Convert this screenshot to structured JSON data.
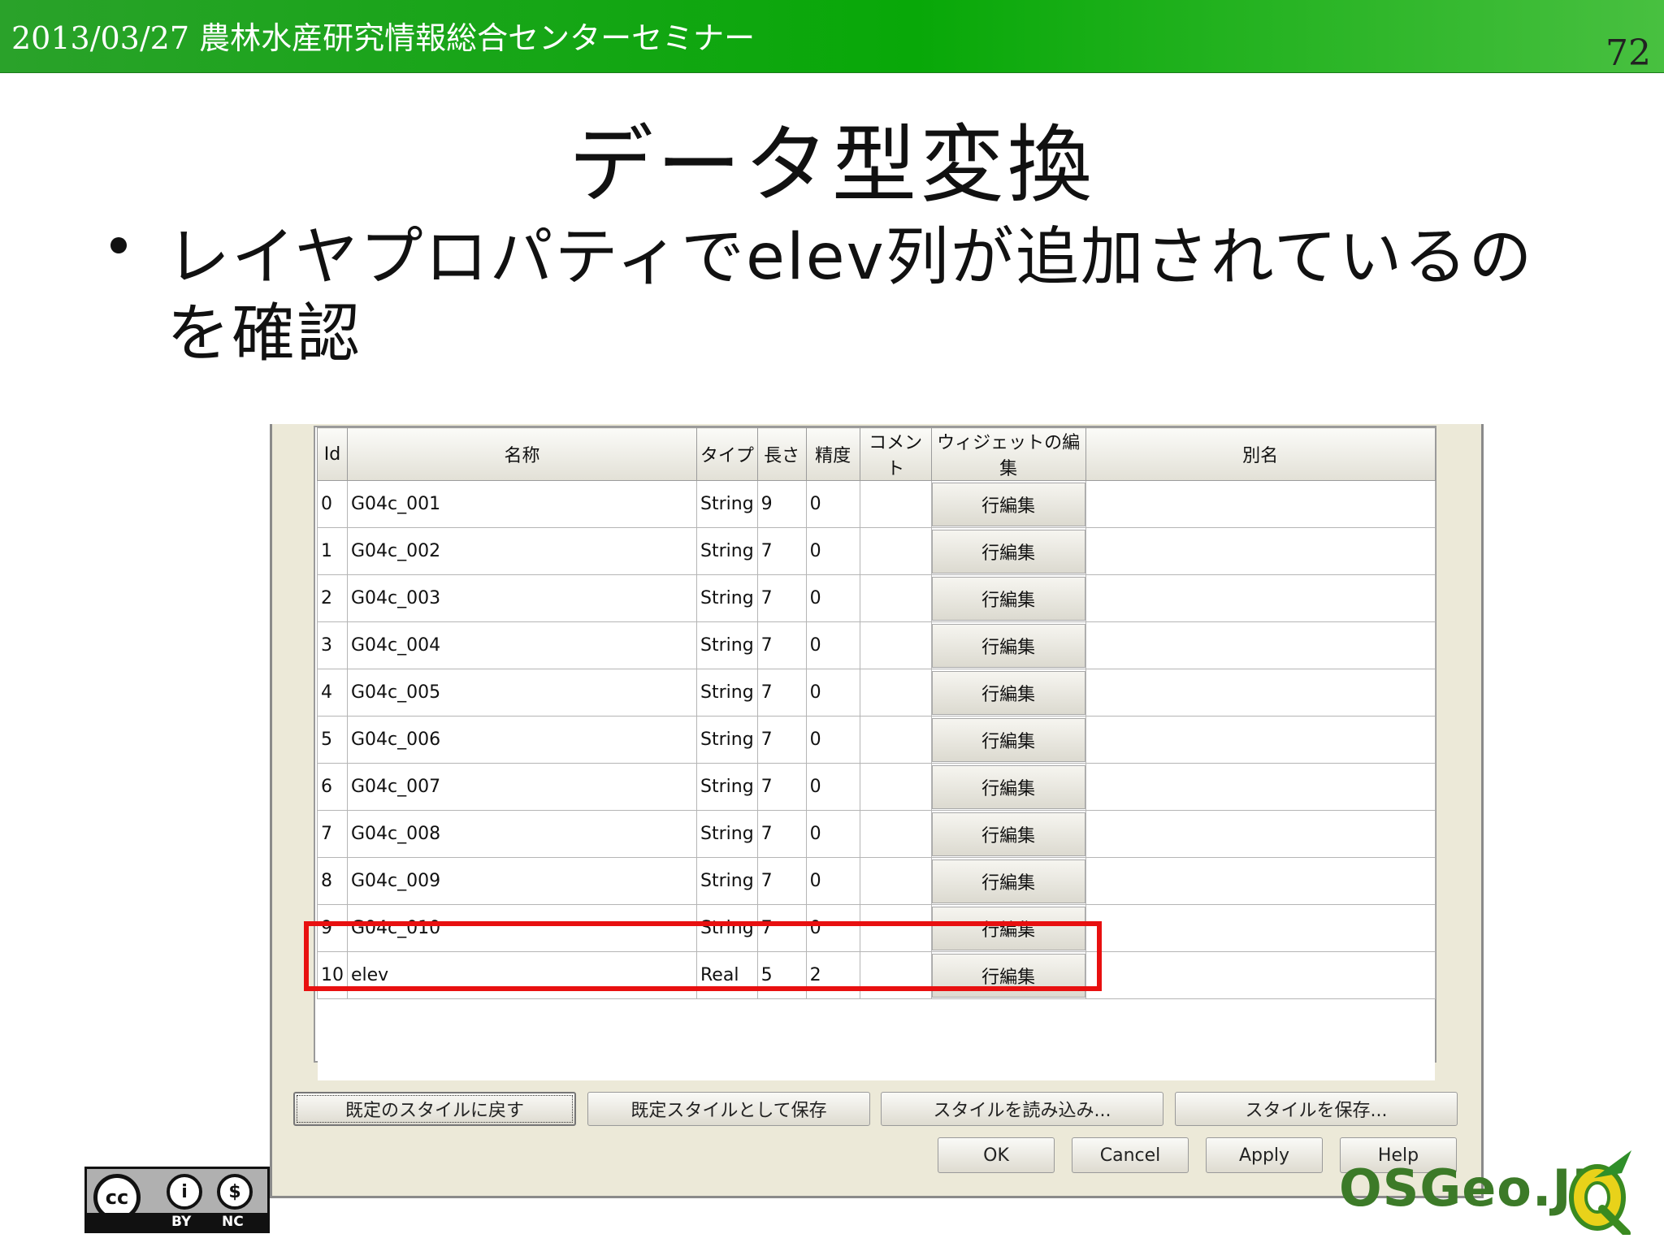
{
  "header": {
    "title": "2013/03/27 農林水産研究情報総合センターセミナー",
    "page_number": "72"
  },
  "slide": {
    "title": "データ型変換",
    "bullet": "レイヤプロパティでelev列が追加されているのを確認"
  },
  "table": {
    "columns": [
      "Id",
      "名称",
      "タイプ",
      "長さ",
      "精度",
      "コメント",
      "ウィジェットの編集",
      "別名"
    ],
    "rows": [
      {
        "id": "0",
        "name": "G04c_001",
        "type": "String",
        "length": "9",
        "precision": "0",
        "comment": "",
        "edit": "行編集",
        "alias": ""
      },
      {
        "id": "1",
        "name": "G04c_002",
        "type": "String",
        "length": "7",
        "precision": "0",
        "comment": "",
        "edit": "行編集",
        "alias": ""
      },
      {
        "id": "2",
        "name": "G04c_003",
        "type": "String",
        "length": "7",
        "precision": "0",
        "comment": "",
        "edit": "行編集",
        "alias": ""
      },
      {
        "id": "3",
        "name": "G04c_004",
        "type": "String",
        "length": "7",
        "precision": "0",
        "comment": "",
        "edit": "行編集",
        "alias": ""
      },
      {
        "id": "4",
        "name": "G04c_005",
        "type": "String",
        "length": "7",
        "precision": "0",
        "comment": "",
        "edit": "行編集",
        "alias": ""
      },
      {
        "id": "5",
        "name": "G04c_006",
        "type": "String",
        "length": "7",
        "precision": "0",
        "comment": "",
        "edit": "行編集",
        "alias": ""
      },
      {
        "id": "6",
        "name": "G04c_007",
        "type": "String",
        "length": "7",
        "precision": "0",
        "comment": "",
        "edit": "行編集",
        "alias": ""
      },
      {
        "id": "7",
        "name": "G04c_008",
        "type": "String",
        "length": "7",
        "precision": "0",
        "comment": "",
        "edit": "行編集",
        "alias": ""
      },
      {
        "id": "8",
        "name": "G04c_009",
        "type": "String",
        "length": "7",
        "precision": "0",
        "comment": "",
        "edit": "行編集",
        "alias": ""
      },
      {
        "id": "9",
        "name": "G04c_010",
        "type": "String",
        "length": "7",
        "precision": "0",
        "comment": "",
        "edit": "行編集",
        "alias": ""
      },
      {
        "id": "10",
        "name": "elev",
        "type": "Real",
        "length": "5",
        "precision": "2",
        "comment": "",
        "edit": "行編集",
        "alias": ""
      }
    ]
  },
  "style_buttons": {
    "restore_default": "既定のスタイルに戻す",
    "save_as_default": "既定スタイルとして保存",
    "load_style": "スタイルを読み込み...",
    "save_style": "スタイルを保存..."
  },
  "dialog_buttons": {
    "ok": "OK",
    "cancel": "Cancel",
    "apply": "Apply",
    "help": "Help"
  },
  "footer": {
    "license_icon": "cc-by-nc-icon",
    "cc_label": "cc",
    "by_label": "BY",
    "nc_label": "NC",
    "osgeo_text": "OSGeo.JP",
    "qgis_icon": "qgis-logo-icon"
  },
  "colors": {
    "header_green": "#08a808",
    "highlight_red": "#e81010",
    "dialog_bg": "#ece9d8"
  }
}
